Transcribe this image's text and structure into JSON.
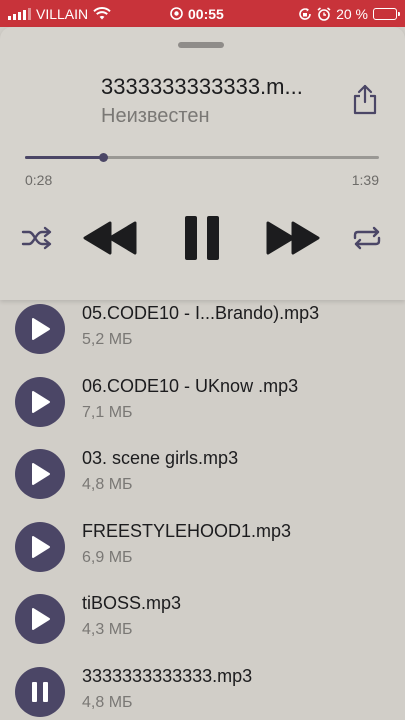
{
  "status_bar": {
    "carrier": "VILLAIN",
    "time": "00:55",
    "battery_text": "20 %",
    "battery_level": 0.2,
    "background_color": "#c8333a"
  },
  "player": {
    "title": "3333333333333.m...",
    "artist": "Неизвестен",
    "elapsed": "0:28",
    "duration": "1:39",
    "progress_fraction": 0.22,
    "accent_color": "#4b4666",
    "controls": [
      "shuffle-icon",
      "rewind-icon",
      "pause-icon",
      "fast-forward-icon",
      "repeat-icon"
    ]
  },
  "songs": [
    {
      "name": "05.CODE10 - I...Brando).mp3",
      "size": "5,2 МБ",
      "state": "play"
    },
    {
      "name": "06.CODE10 - UKnow .mp3",
      "size": "7,1 МБ",
      "state": "play"
    },
    {
      "name": "03. scene girls.mp3",
      "size": "4,8 МБ",
      "state": "play"
    },
    {
      "name": "FREESTYLEHOOD1.mp3",
      "size": "6,9 МБ",
      "state": "play"
    },
    {
      "name": "tiBOSS.mp3",
      "size": "4,3 МБ",
      "state": "play"
    },
    {
      "name": "3333333333333.mp3",
      "size": "4,8 МБ",
      "state": "pause"
    }
  ]
}
